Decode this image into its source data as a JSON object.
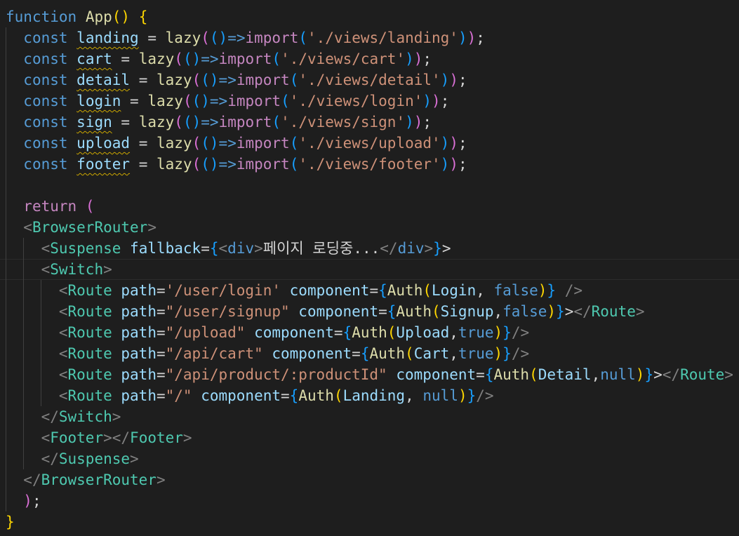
{
  "code": {
    "lines": [
      "function App() {",
      "  const landing = lazy(()=>import('./views/landing'));",
      "  const cart = lazy(()=>import('./views/cart'));",
      "  const detail = lazy(()=>import('./views/detail'));",
      "  const login = lazy(()=>import('./views/login'));",
      "  const sign = lazy(()=>import('./views/sign'));",
      "  const upload = lazy(()=>import('./views/upload'));",
      "  const footer = lazy(()=>import('./views/footer'));",
      "",
      "  return (",
      "  <BrowserRouter>",
      "    <Suspense fallback={<div>페이지 로딩중...</div>}>",
      "    <Switch>",
      "      <Route path='/user/login' component={Auth(Login, false)} />",
      "      <Route path=\"/user/signup\" component={Auth(Signup,false)}></Route>",
      "      <Route path=\"/upload\" component={Auth(Upload,true)}/>",
      "      <Route path=\"/api/cart\" component={Auth(Cart,true)}/>",
      "      <Route path=\"/api/product/:productId\" component={Auth(Detail,null)}></Route>",
      "      <Route path=\"/\" component={Auth(Landing, null)}/>",
      "    </Switch>",
      "    <Footer></Footer>",
      "    </Suspense>",
      "  </BrowserRouter>",
      "  );",
      "}"
    ]
  },
  "colors": {
    "background": "#1e1e1e",
    "keyword": "#569cd6",
    "control_keyword": "#c586c0",
    "function": "#dcdcaa",
    "variable": "#9cdcfe",
    "string": "#ce9178",
    "jsx_tag": "#4ec9b0",
    "angle_bracket": "#808080",
    "bracket_level_1": "#ffd700",
    "bracket_level_2": "#da70d6",
    "bracket_level_3": "#179fff",
    "warning_squiggle": "#cca700"
  },
  "editor": {
    "current_line": 13,
    "warned_identifiers": [
      "landing",
      "cart",
      "detail",
      "login",
      "sign",
      "upload",
      "footer"
    ]
  }
}
